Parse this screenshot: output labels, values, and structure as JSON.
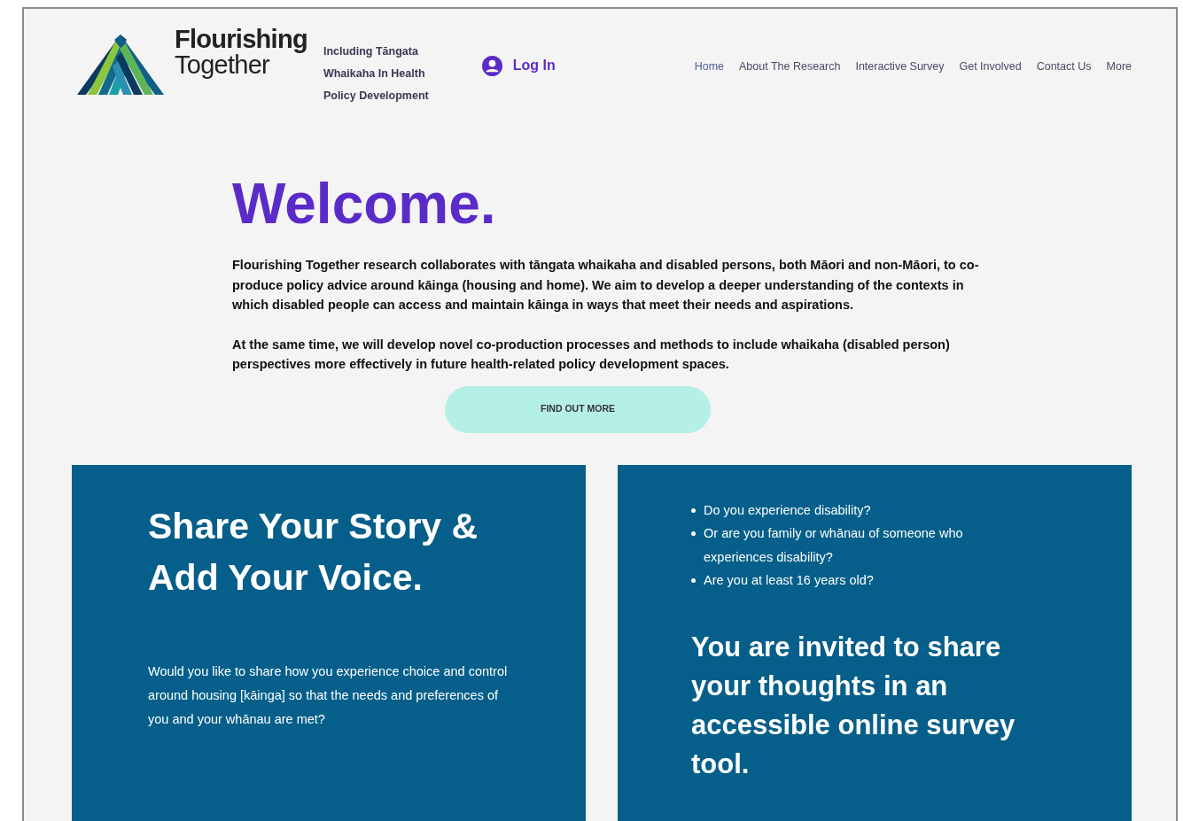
{
  "header": {
    "logo_line_1": "Flourishing",
    "logo_line_2": "Together",
    "tagline": [
      "Including Tāngata",
      "Whaikaha In Health",
      "Policy Development"
    ],
    "login": "Log In"
  },
  "nav": [
    {
      "label": "Home",
      "selected": true
    },
    {
      "label": "About The Research",
      "selected": false
    },
    {
      "label": "Interactive Survey",
      "selected": false
    },
    {
      "label": "Get Involved",
      "selected": false
    },
    {
      "label": "Contact Us",
      "selected": false
    },
    {
      "label": "More",
      "selected": false
    }
  ],
  "intro": {
    "title": "Welcome.",
    "paragraphs": [
      "Flourishing Together research collaborates with tāngata whaikaha and disabled persons, both Māori and non-Māori, to co-produce policy advice around kāinga (housing and home). We aim to develop a deeper understanding of the contexts in which disabled people can access and maintain kāinga in ways that meet their needs and aspirations.",
      "At the same time, we will develop novel co-production processes and methods to include whaikaha (disabled person) perspectives more effectively in future health-related policy development spaces."
    ],
    "button": "FIND OUT MORE"
  },
  "left_panel": {
    "heading": "Share Your Story & Add Your Voice.",
    "text": "Would you like to share how you experience choice and control around housing [kāinga] so that the needs and preferences of you and your whānau are met?"
  },
  "right_panel": {
    "questions": [
      "Do you experience disability?",
      "Or are you family or whānau of someone who experiences disability?",
      "Are you at least 16 years old?"
    ],
    "invitation": "You are invited to share your thoughts in an accessible online survey tool."
  }
}
